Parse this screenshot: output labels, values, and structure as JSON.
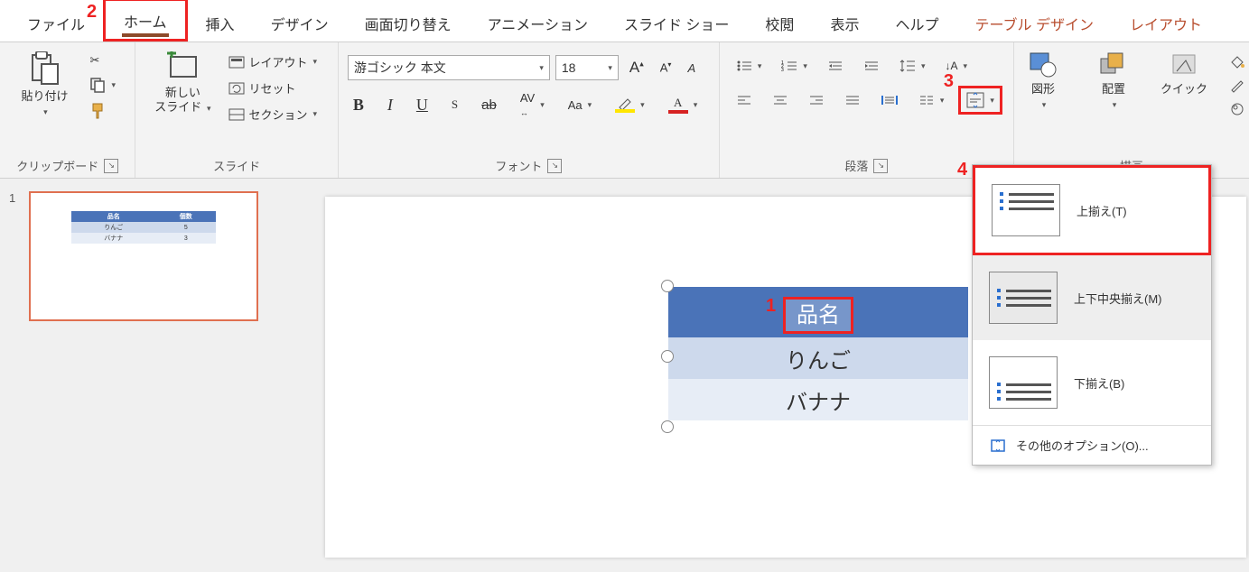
{
  "tabs": {
    "file": "ファイル",
    "home": "ホーム",
    "insert": "挿入",
    "design": "デザイン",
    "transitions": "画面切り替え",
    "animations": "アニメーション",
    "slideshow": "スライド ショー",
    "review": "校閲",
    "view": "表示",
    "help": "ヘルプ",
    "table_design": "テーブル デザイン",
    "layout": "レイアウト"
  },
  "ribbon": {
    "clipboard": {
      "paste": "貼り付け",
      "group": "クリップボード"
    },
    "slides": {
      "new_slide": "新しい\nスライド",
      "layout": "レイアウト",
      "reset": "リセット",
      "section": "セクション",
      "group": "スライド"
    },
    "font": {
      "name": "游ゴシック 本文",
      "size": "18",
      "group": "フォント"
    },
    "paragraph": {
      "group": "段落"
    },
    "drawing": {
      "shapes": "図形",
      "arrange": "配置",
      "quick": "クイック",
      "group": "描画"
    },
    "aa": "Aa"
  },
  "align_menu": {
    "top": "上揃え(T)",
    "middle": "上下中央揃え(M)",
    "bottom": "下揃え(B)",
    "more": "その他のオプション(O)..."
  },
  "thumb": {
    "index": "1"
  },
  "table": {
    "header": "品名",
    "row1": "りんご",
    "row2": "バナナ"
  },
  "thumb_table": {
    "h1": "品名",
    "h2": "個数",
    "r1c1": "りんご",
    "r1c2": "5",
    "r2c1": "バナナ",
    "r2c2": "3"
  },
  "anno": {
    "n1": "1",
    "n2": "2",
    "n3": "3",
    "n4": "4"
  }
}
